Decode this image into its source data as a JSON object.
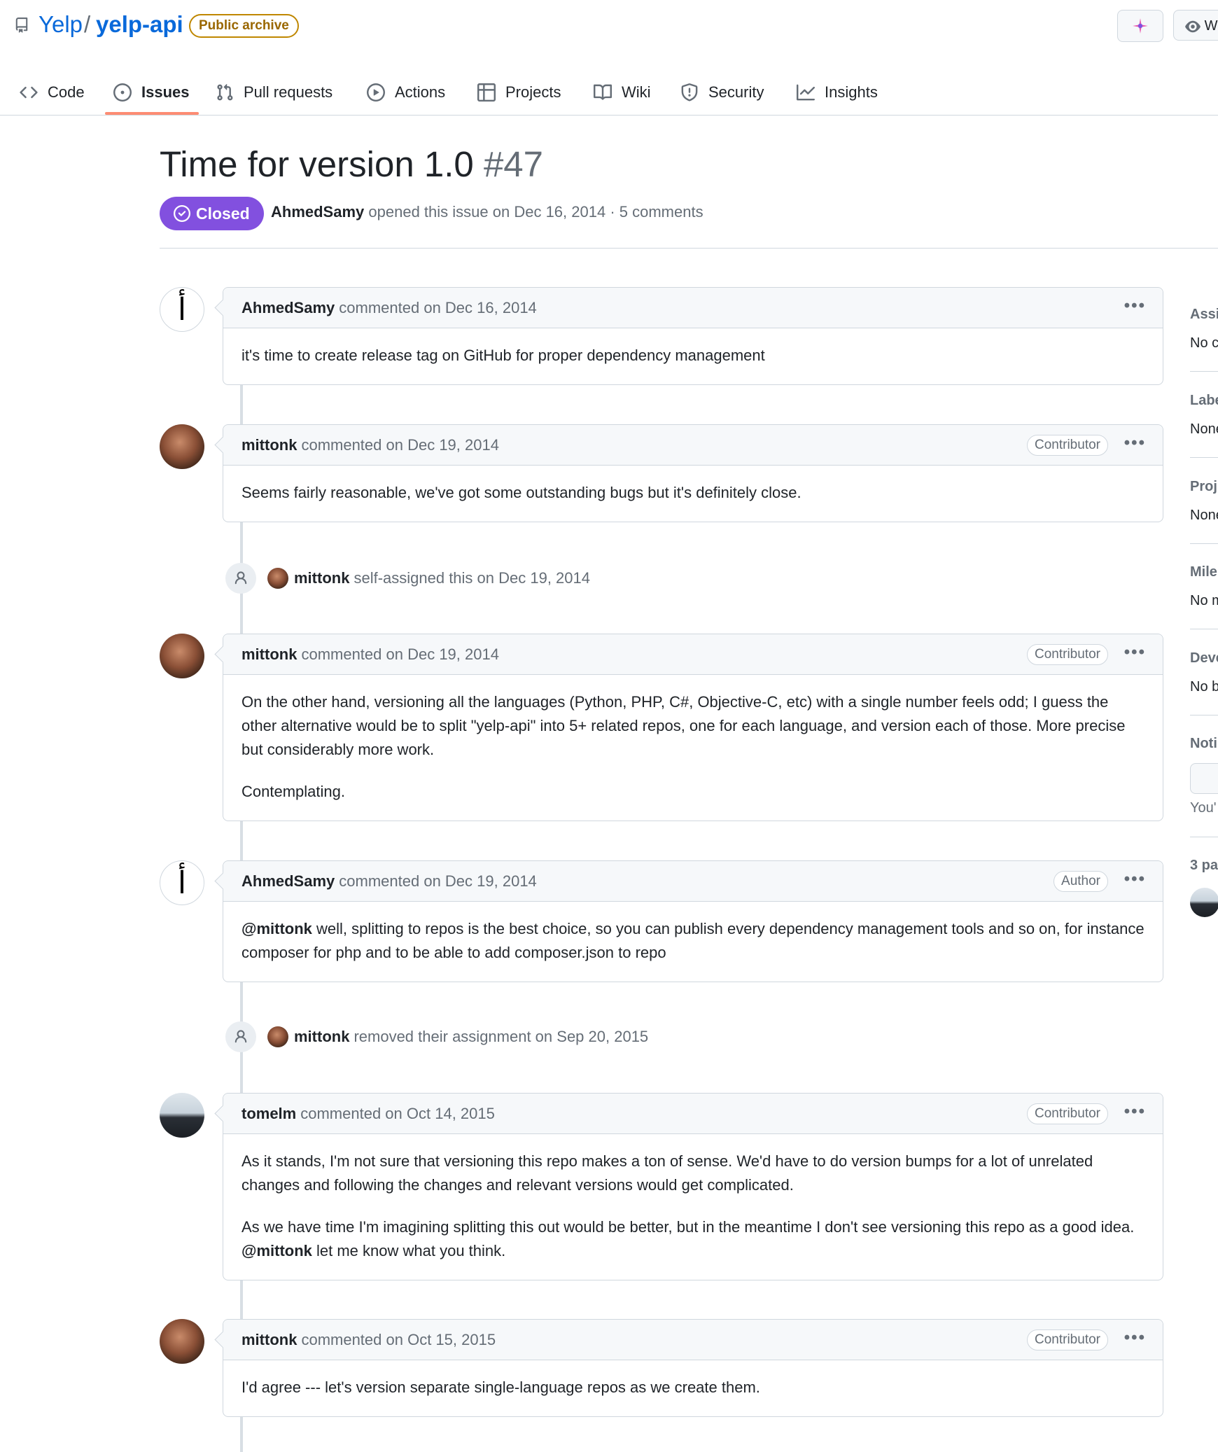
{
  "repo": {
    "owner": "Yelp",
    "separator": "/",
    "name": "yelp-api",
    "archive_badge": "Public archive",
    "watch_label": "W"
  },
  "tabs": [
    {
      "label": "Code",
      "icon": "code-icon"
    },
    {
      "label": "Issues",
      "icon": "issue-icon",
      "active": true
    },
    {
      "label": "Pull requests",
      "icon": "pull-request-icon"
    },
    {
      "label": "Actions",
      "icon": "play-icon"
    },
    {
      "label": "Projects",
      "icon": "table-icon"
    },
    {
      "label": "Wiki",
      "icon": "book-icon"
    },
    {
      "label": "Security",
      "icon": "shield-icon"
    },
    {
      "label": "Insights",
      "icon": "graph-icon"
    }
  ],
  "issue": {
    "title": "Time for version 1.0",
    "number": "#47",
    "state": "Closed",
    "author": "AhmedSamy",
    "meta_text": "opened this issue on Dec 16, 2014 · 5 comments"
  },
  "comments": [
    {
      "author": "AhmedSamy",
      "action": "commented on Dec 16, 2014",
      "role": "",
      "paragraphs": [
        "it's time to create release tag on GitHub for proper dependency management"
      ]
    },
    {
      "author": "mittonk",
      "action": "commented on Dec 19, 2014",
      "role": "Contributor",
      "paragraphs": [
        "Seems fairly reasonable, we've got some outstanding bugs but it's definitely close."
      ]
    },
    {
      "author": "mittonk",
      "action": "commented on Dec 19, 2014",
      "role": "Contributor",
      "paragraphs": [
        "On the other hand, versioning all the languages (Python, PHP, C#, Objective-C, etc) with a single number feels odd; I guess the other alternative would be to split \"yelp-api\" into 5+ related repos, one for each language, and version each of those. More precise but considerably more work.",
        "Contemplating."
      ]
    },
    {
      "author": "AhmedSamy",
      "action": "commented on Dec 19, 2014",
      "role": "Author",
      "mention": "@mittonk",
      "paragraphs": [
        " well, splitting to repos is the best choice, so you can publish every dependency management tools and so on, for instance composer for php and to be able to add composer.json to repo"
      ]
    },
    {
      "author": "tomelm",
      "action": "commented on Oct 14, 2015",
      "role": "Contributor",
      "paragraphs": [
        "As it stands, I'm not sure that versioning this repo makes a ton of sense. We'd have to do version bumps for a lot of unrelated changes and following the changes and relevant versions would get complicated."
      ],
      "p2_before": "As we have time I'm imagining splitting this out would be better, but in the meantime I don't see versioning this repo as a good idea. ",
      "p2_mention": "@mittonk",
      "p2_after": " let me know what you think."
    },
    {
      "author": "mittonk",
      "action": "commented on Oct 15, 2015",
      "role": "Contributor",
      "paragraphs": [
        "I'd agree --- let's version separate single-language repos as we create them."
      ]
    }
  ],
  "events": [
    {
      "who": "mittonk",
      "text": "self-assigned this on Dec 19, 2014"
    },
    {
      "who": "mittonk",
      "text": "removed their assignment on Sep 20, 2015"
    }
  ],
  "avatar_glyph": "أ",
  "comment_menu": "•••",
  "sidebar": {
    "assignees_head": "Assi",
    "assignees_val": "No c",
    "labels_head": "Labe",
    "labels_val": "None",
    "projects_head": "Proj",
    "projects_val": "None",
    "milestone_head": "Mile",
    "milestone_val": "No m",
    "development_head": "Deve",
    "development_val": "No b",
    "notifications_head": "Noti",
    "notifications_val": "You'",
    "participants_head": "3 pa"
  },
  "colors": {
    "accent": "#0969da",
    "closed": "#8250df",
    "tab_underline": "#fd8c73",
    "archive": "#9a6700"
  }
}
